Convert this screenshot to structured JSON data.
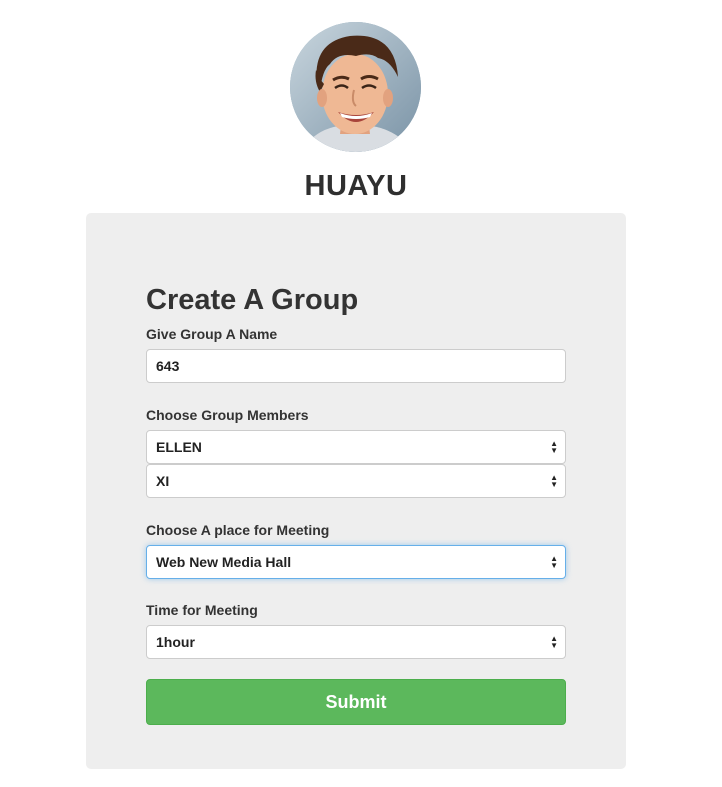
{
  "profile": {
    "username": "HUAYU",
    "avatar_icon": "user-photo"
  },
  "form": {
    "title": "Create A Group",
    "group_name": {
      "label": "Give Group A Name",
      "value": "643"
    },
    "members": {
      "label": "Choose Group Members",
      "selected": [
        "ELLEN",
        "XI"
      ]
    },
    "place": {
      "label": "Choose A place for Meeting",
      "selected": "Web New Media Hall"
    },
    "time": {
      "label": "Time for Meeting",
      "selected": "1hour"
    },
    "submit_label": "Submit"
  },
  "colors": {
    "card_background": "#eeeeee",
    "submit_green": "#5cb85c",
    "focus_blue": "#66afe9"
  }
}
